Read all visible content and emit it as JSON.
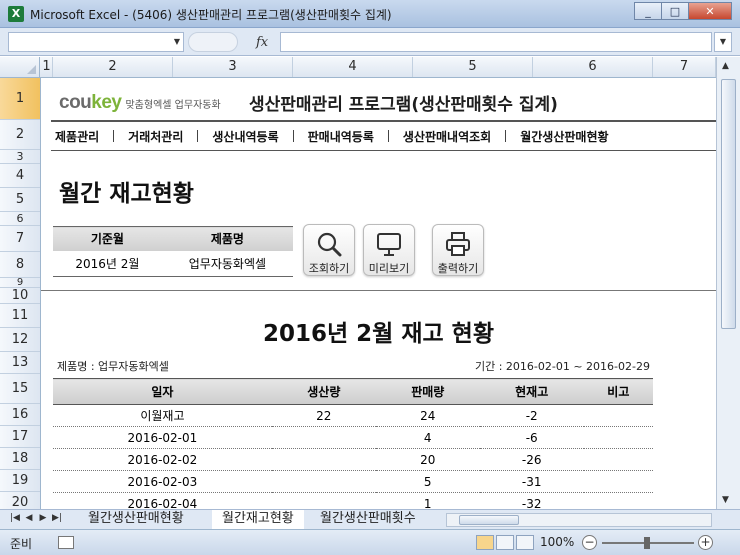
{
  "window": {
    "title": "Microsoft Excel - (5406) 생산판매관리 프로그램(생산판매횟수 집계)",
    "minimize": "_",
    "maximize": "□",
    "close": "✕"
  },
  "formula_bar": {
    "fx_label": "fx",
    "name_value": "",
    "formula_value": ""
  },
  "columns": [
    "1",
    "2",
    "3",
    "4",
    "5",
    "6",
    "7"
  ],
  "rows": [
    "1",
    "2",
    "3",
    "4",
    "5",
    "6",
    "7",
    "8",
    "9",
    "10",
    "11",
    "12",
    "13",
    "15",
    "16",
    "17",
    "18",
    "19",
    "20"
  ],
  "brand": {
    "logo_main": "cou",
    "logo_accent": "key",
    "tagline": "맞춤형엑셀 업무자동화"
  },
  "program_title": "생산판매관리 프로그램(생산판매횟수 집계)",
  "nav": [
    "제품관리",
    "거래처관리",
    "생산내역등록",
    "판매내역등록",
    "생산판매내역조회",
    "월간생산판매현황"
  ],
  "page_heading": "월간 재고현황",
  "filter": {
    "headers": [
      "기준월",
      "제품명"
    ],
    "values": [
      "2016년 2월",
      "업무자동화엑셀"
    ]
  },
  "tools": [
    {
      "label": "조회하기",
      "icon": "magnifier-icon"
    },
    {
      "label": "미리보기",
      "icon": "monitor-icon"
    },
    {
      "label": "출력하기",
      "icon": "printer-icon"
    }
  ],
  "report": {
    "title": "2016년 2월 재고 현황",
    "meta_left": "제품명 : 업무자동화엑셀",
    "meta_right": "기간 : 2016-02-01 ~ 2016-02-29",
    "headers": [
      "일자",
      "생산량",
      "판매량",
      "현재고",
      "비고"
    ],
    "rows": [
      [
        "이월재고",
        "22",
        "24",
        "-2",
        ""
      ],
      [
        "2016-02-01",
        "",
        "4",
        "-6",
        ""
      ],
      [
        "2016-02-02",
        "",
        "20",
        "-26",
        ""
      ],
      [
        "2016-02-03",
        "",
        "5",
        "-31",
        ""
      ],
      [
        "2016-02-04",
        "",
        "1",
        "-32",
        ""
      ]
    ]
  },
  "sheet_tabs": [
    "월간생산판매현황",
    "월간재고현황",
    "월간생산판매횟수"
  ],
  "status": {
    "ready": "준비",
    "zoom": "100%"
  }
}
